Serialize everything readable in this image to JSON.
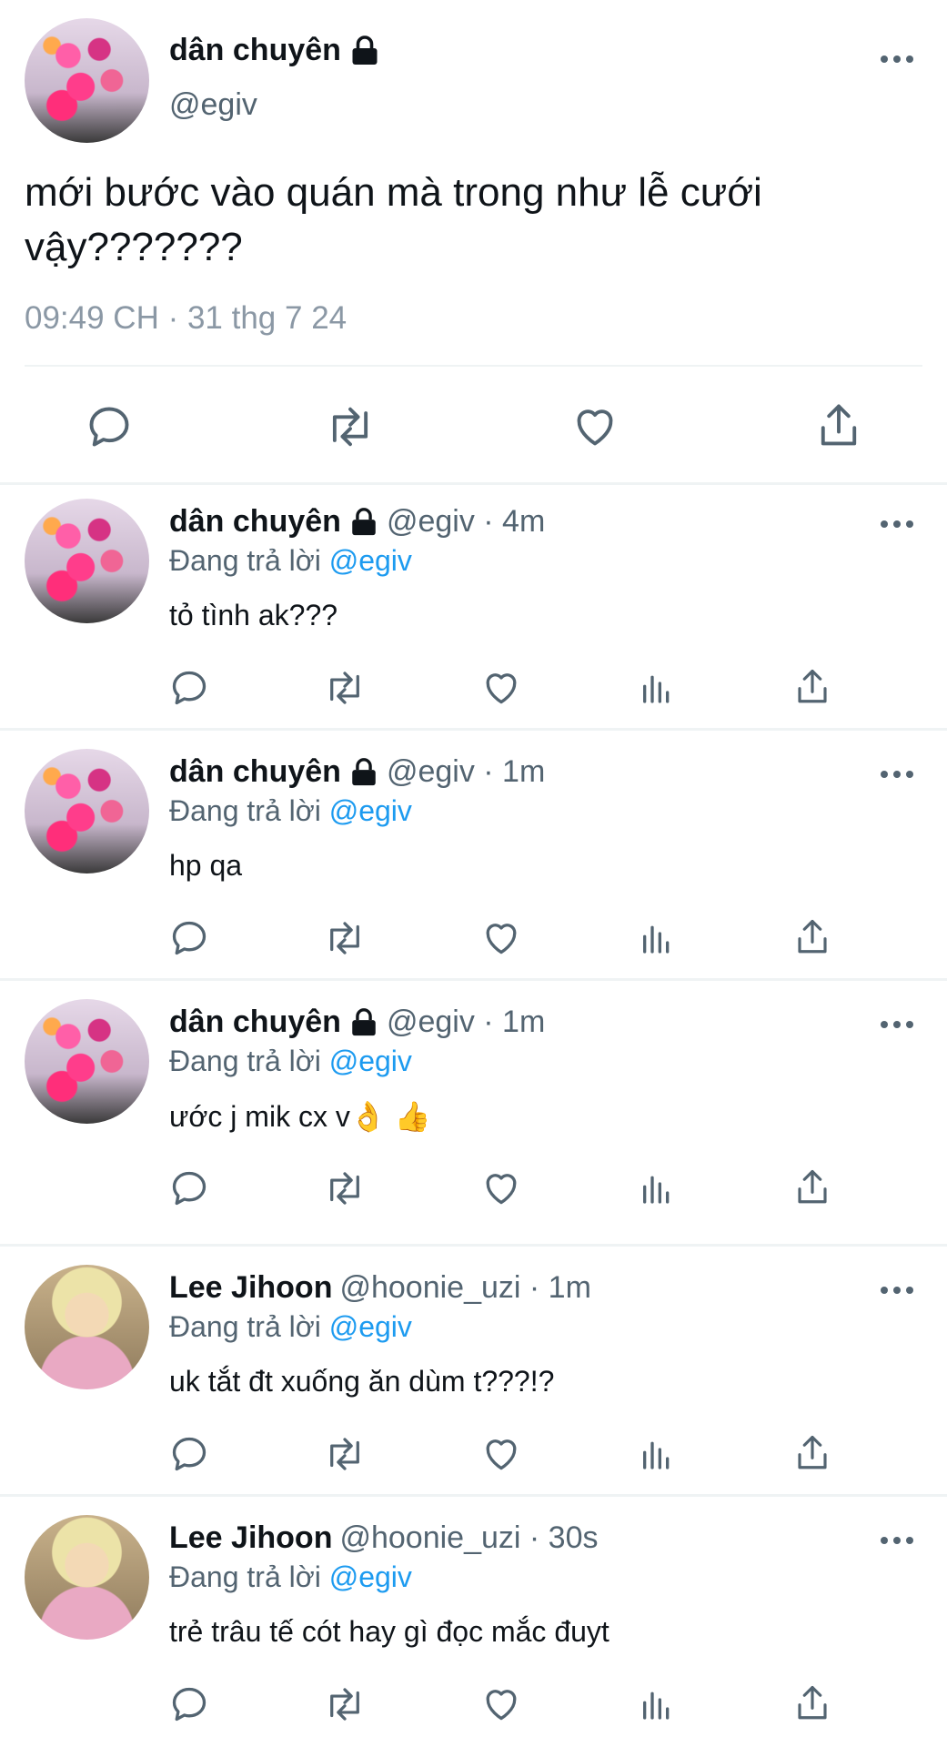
{
  "main_tweet": {
    "author_name": "dân chuyên",
    "author_handle": "@egiv",
    "text_line1": "mới bước vào quán mà trong như lễ cưới",
    "text_line2": "vậy???????",
    "timestamp": "09:49 CH · 31 thg 7 24",
    "actions": [
      "reply-icon",
      "retweet-icon",
      "like-icon",
      "share-icon"
    ]
  },
  "replies": [
    {
      "name": "dân chuyên",
      "handle": "@egiv · 4m",
      "replying_label": "Đang trả lời",
      "replying_to": "@egiv",
      "text": "tỏ tình ak???",
      "locked": true
    },
    {
      "name": "dân chuyên",
      "handle": "@egiv · 1m",
      "replying_label": "Đang trả lời",
      "replying_to": "@egiv",
      "text": "hp qa",
      "locked": true
    },
    {
      "name": "dân chuyên",
      "handle": "@egiv · 1m",
      "replying_label": "Đang trả lời",
      "replying_to": "@egiv",
      "text": "ước j mik cx v",
      "emoji": "👌 👍",
      "locked": true
    },
    {
      "name": "Lee Jihoon",
      "handle": "@hoonie_uzi · 1m",
      "replying_label": "Đang trả lời",
      "replying_to": "@egiv",
      "text": "uk tắt đt xuống ăn dùm t???!?",
      "locked": false
    },
    {
      "name": "Lee Jihoon",
      "handle": "@hoonie_uzi · 30s",
      "replying_label": "Đang trả lời",
      "replying_to": "@egiv",
      "text": "trẻ trâu tế cót hay gì đọc mắc đuyt",
      "locked": false
    }
  ],
  "colors": {
    "accent": "#1d9bf0",
    "secondary_text": "#536471",
    "divider": "#eff3f4"
  }
}
